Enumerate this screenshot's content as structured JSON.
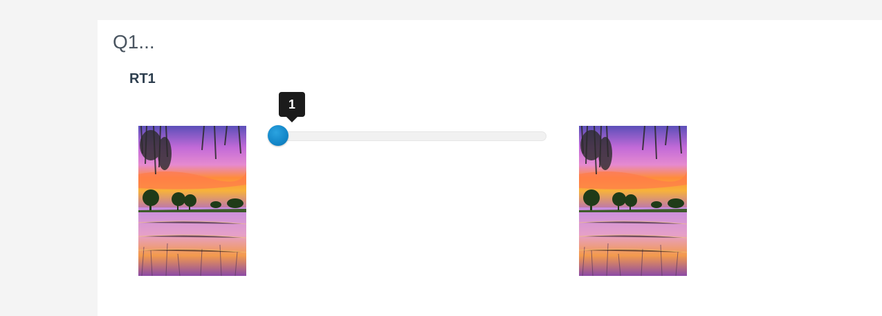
{
  "question": {
    "title": "Q1..."
  },
  "row": {
    "label": "RT1",
    "slider": {
      "value": "1",
      "min": 1,
      "max": 10
    },
    "left_image": {
      "icon": "sunset-lake-image"
    },
    "right_image": {
      "icon": "sunset-lake-image"
    }
  },
  "colors": {
    "page_bg": "#f4f4f4",
    "card_bg": "#ffffff",
    "handle": "#1386c8",
    "tooltip_bg": "#1b1b1b"
  }
}
